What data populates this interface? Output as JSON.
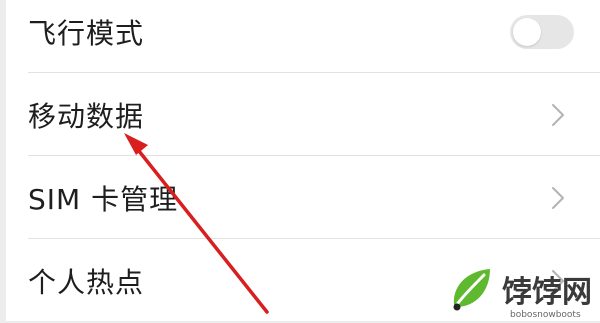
{
  "settings": {
    "items": [
      {
        "label": "飞行模式",
        "control": "toggle",
        "toggle_on": false
      },
      {
        "label": "移动数据",
        "control": "chevron"
      },
      {
        "label": "SIM 卡管理",
        "control": "chevron"
      },
      {
        "label": "个人热点",
        "control": "chevron"
      }
    ]
  },
  "annotation": {
    "arrow_color": "#d81e1e"
  },
  "watermark": {
    "brand": "饽饽网",
    "url": "bobosnowboots"
  },
  "colors": {
    "toggle_off": "#e6e6e6",
    "chevron": "#b3b3b3",
    "divider": "#e2e2e2",
    "logo_green": "#5fb92f"
  }
}
